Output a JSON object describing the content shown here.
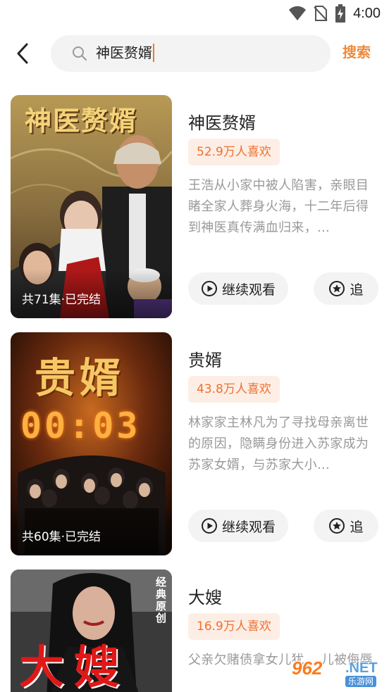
{
  "status_bar": {
    "time": "4:00"
  },
  "header": {
    "search_value": "神医赘婿",
    "search_button": "搜索"
  },
  "results": [
    {
      "title": "神医赘婿",
      "poster_title": "神医赘婿",
      "episodes": "共71集·已完结",
      "likes": "52.9万人喜欢",
      "description": "王浩从小家中被人陷害，亲眼目睹全家人葬身火海，十二年后得到神医真传满血归来，...",
      "watch_label": "继续观看",
      "follow_label": "追"
    },
    {
      "title": "贵婿",
      "poster_title": "贵婿",
      "poster_subtitle": "00:03",
      "episodes": "共60集·已完结",
      "likes": "43.8万人喜欢",
      "description": "林家家主林凡为了寻找母亲离世的原因，隐瞒身份进入苏家成为苏家女婿，与苏家大小...",
      "watch_label": "继续观看",
      "follow_label": "追"
    },
    {
      "title": "大嫂",
      "poster_title": "大嫂",
      "poster_badge": "经典原创",
      "likes": "16.9万人喜欢",
      "description": "父亲欠赌债拿女儿犹... 儿被侮辱"
    }
  ],
  "watermark": {
    "number": "962",
    "net": ".NET",
    "sub": "乐游网"
  },
  "colors": {
    "accent": "#f08a3a",
    "likes_bg": "#fdeee5",
    "likes_text": "#f07030"
  }
}
